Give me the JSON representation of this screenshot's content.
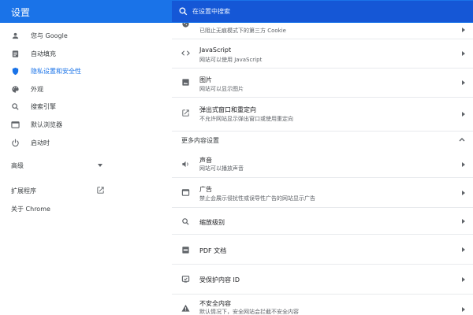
{
  "app": {
    "title": "设置"
  },
  "search": {
    "placeholder": "在设置中搜索"
  },
  "sidebar": {
    "items": [
      {
        "label": "您与 Google",
        "icon": "person-icon"
      },
      {
        "label": "自动填充",
        "icon": "clipboard-icon"
      },
      {
        "label": "隐私设置和安全性",
        "icon": "shield-icon",
        "active": true
      },
      {
        "label": "外观",
        "icon": "palette-icon"
      },
      {
        "label": "搜索引擎",
        "icon": "search-icon"
      },
      {
        "label": "默认浏览器",
        "icon": "browser-icon"
      },
      {
        "label": "启动时",
        "icon": "power-icon"
      }
    ],
    "advanced": "高级",
    "extensions": "扩展程序",
    "about": "关于 Chrome"
  },
  "content": {
    "partial_subtitle": "已阻止无痕模式下的第三方 Cookie",
    "rows": [
      {
        "title": "JavaScript",
        "subtitle": "网站可以使用 JavaScript",
        "icon": "code-icon"
      },
      {
        "title": "图片",
        "subtitle": "网站可以显示图片",
        "icon": "image-icon"
      },
      {
        "title": "弹出式窗口和重定向",
        "subtitle": "不允许网站显示弹出窗口或使用重定向",
        "icon": "popup-icon"
      }
    ],
    "more_section": "更多内容设置",
    "more_rows": [
      {
        "title": "声音",
        "subtitle": "网站可以播放声音",
        "icon": "speaker-icon"
      },
      {
        "title": "广告",
        "subtitle": "禁止会展示侵扰性或误导性广告的网站显示广告",
        "icon": "ads-icon"
      },
      {
        "title": "缩放级别",
        "icon": "zoom-icon"
      },
      {
        "title": "PDF 文档",
        "icon": "pdf-icon"
      },
      {
        "title": "受保护内容 ID",
        "icon": "protected-content-icon"
      },
      {
        "title": "不安全内容",
        "subtitle": "默认情况下，安全网站会拦截不安全内容",
        "icon": "warning-icon"
      }
    ]
  },
  "colors": {
    "accent": "#1a73e8",
    "search_bg": "#1557d6",
    "text": "#202124",
    "secondary": "#5f6368"
  }
}
